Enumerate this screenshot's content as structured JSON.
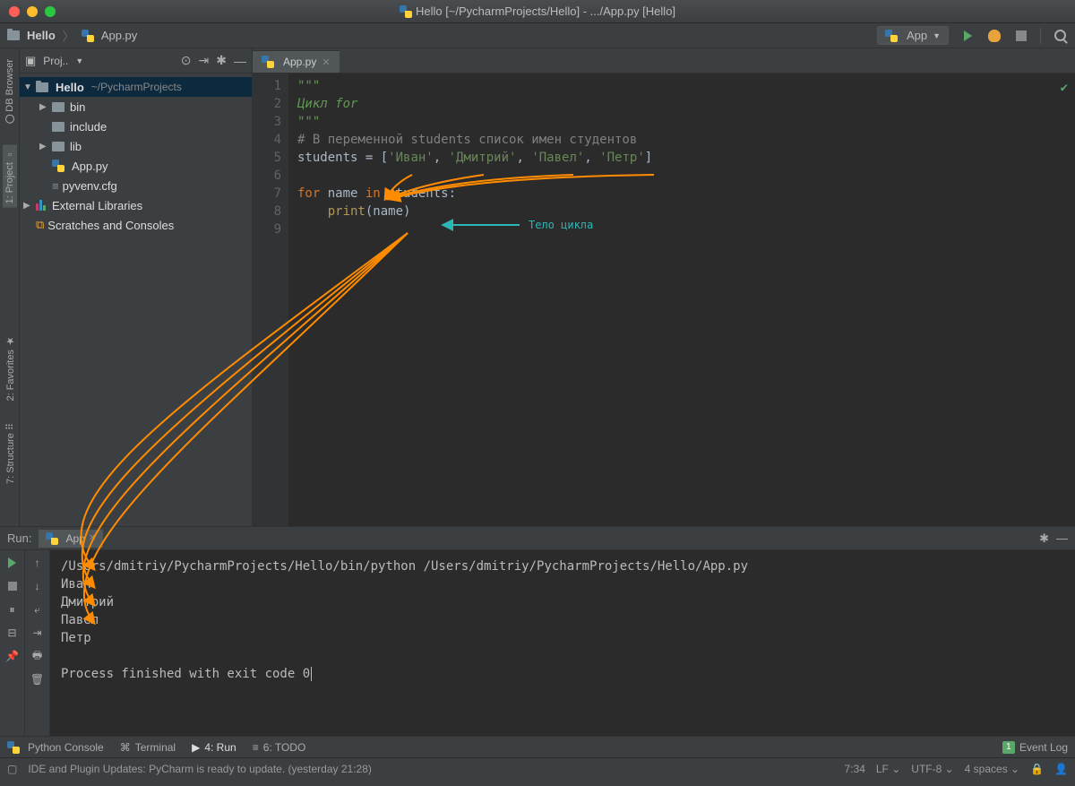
{
  "window": {
    "title": "Hello [~/PycharmProjects/Hello] - .../App.py [Hello]"
  },
  "breadcrumb": {
    "project": "Hello",
    "file": "App.py"
  },
  "runconfig": {
    "name": "App"
  },
  "left_tools": {
    "db": "DB Browser",
    "project": "1: Project",
    "favorites": "2: Favorites",
    "structure": "7: Structure"
  },
  "project_panel": {
    "title": "Proj..",
    "tree": {
      "root": "Hello",
      "root_path": "~/PycharmProjects",
      "bin": "bin",
      "include": "include",
      "lib": "lib",
      "app": "App.py",
      "pyvenv": "pyvenv.cfg",
      "ext": "External Libraries",
      "scratches": "Scratches and Consoles"
    }
  },
  "editor": {
    "tab": "App.py",
    "lines": [
      "1",
      "2",
      "3",
      "4",
      "5",
      "6",
      "7",
      "8",
      "9"
    ],
    "code": {
      "l1": "\"\"\"",
      "l2_doc": "Цикл for",
      "l3": "\"\"\"",
      "l4_cmt": "# В переменной students список имен студентов",
      "l5_var": "students ",
      "l5_eq": "= [",
      "l5_s1": "'Иван'",
      "l5_c": ", ",
      "l5_s2": "'Дмитрий'",
      "l5_s3": "'Павел'",
      "l5_s4": "'Петр'",
      "l5_end": "]",
      "l7_for": "for ",
      "l7_name": "name",
      "l7_in": " in ",
      "l7_students": "students:",
      "l8_print": "print",
      "l8_paren": "(name)"
    },
    "annotation": "Тело цикла"
  },
  "run": {
    "label": "Run:",
    "tab": "App",
    "command": "/Users/dmitriy/PycharmProjects/Hello/bin/python /Users/dmitriy/PycharmProjects/Hello/App.py",
    "out1": "Иван",
    "out2": "Дмитрий",
    "out3": "Павел",
    "out4": "Петр",
    "exit": "Process finished with exit code 0"
  },
  "bottom_tabs": {
    "pyconsole": "Python Console",
    "terminal": "Terminal",
    "run": "4: Run",
    "todo": "6: TODO",
    "eventlog": "Event Log",
    "eventbadge": "1"
  },
  "status": {
    "msg": "IDE and Plugin Updates: PyCharm is ready to update. (yesterday 21:28)",
    "pos": "7:34",
    "lf": "LF",
    "enc": "UTF-8",
    "indent": "4 spaces"
  }
}
